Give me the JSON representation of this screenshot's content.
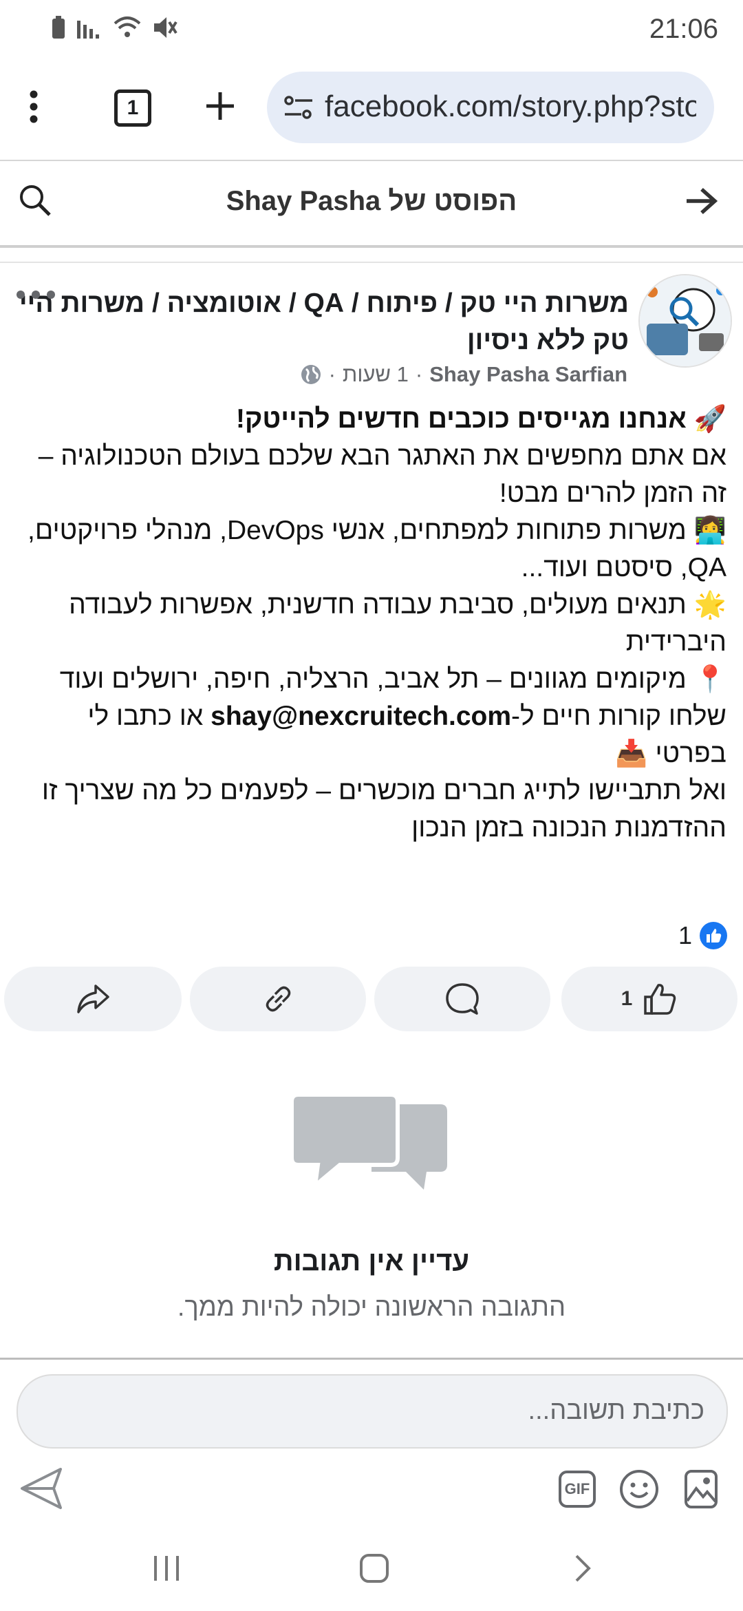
{
  "status_bar": {
    "time": "21:06"
  },
  "browser": {
    "url": "facebook.com/story.php?sto",
    "tab_count": "1"
  },
  "header": {
    "title": "הפוסט של Shay Pasha"
  },
  "post": {
    "group_name": "משרות היי טק / פיתוח / QA / אוטומציה / משרות היי טק ללא ניסיון",
    "author": "Shay Pasha Sarfian",
    "time": "1 שעות",
    "separator": "·",
    "lines": {
      "l1": "אנחנו מגייסים כוכבים חדשים להייטק!",
      "l2": "אם אתם מחפשים את האתגר הבא שלכם בעולם הטכנולוגיה – זה הזמן להרים מבט!",
      "l3": "משרות פתוחות למפתחים, אנשי DevOps, מנהלי פרויקטים, QA, סיסטם ועוד...",
      "l4": "תנאים מעולים, סביבת עבודה חדשנית, אפשרות לעבודה היברידית",
      "l5": "מיקומים מגוונים – תל אביב, הרצליה, חיפה, ירושלים ועוד",
      "l6_pre": "שלחו קורות חיים ל-",
      "l6_email": "shay@nexcruitech.com",
      "l6_post": " או כתבו לי בפרטי",
      "l7": "ואל תתביישו לתייג חברים מוכשרים – לפעמים כל מה שצריך זו ההזדמנות הנכונה בזמן הנכון"
    },
    "reaction_count": "1",
    "like_count": "1"
  },
  "comments": {
    "empty_title": "עדיין אין תגובות",
    "empty_subtitle": "התגובה הראשונה יכולה להיות ממך.",
    "input_placeholder": "כתיבת תשובה..."
  },
  "composer": {
    "gif_label": "GIF"
  },
  "colors": {
    "accent": "#1877f2",
    "pill_bg": "#f0f2f5",
    "url_bg": "#e6ecf7"
  },
  "icons": [
    "battery-icon",
    "signal-icon",
    "wifi-icon",
    "mute-icon",
    "menu-dots-icon",
    "plus-icon",
    "site-settings-icon",
    "search-icon",
    "arrow-right-icon",
    "globe-icon",
    "more-dots-icon",
    "like-icon",
    "comment-icon",
    "link-icon",
    "share-icon",
    "chat-bubbles-icon",
    "send-icon",
    "gif-icon",
    "emoji-icon",
    "image-icon",
    "recent-apps-icon",
    "home-icon",
    "back-icon"
  ]
}
